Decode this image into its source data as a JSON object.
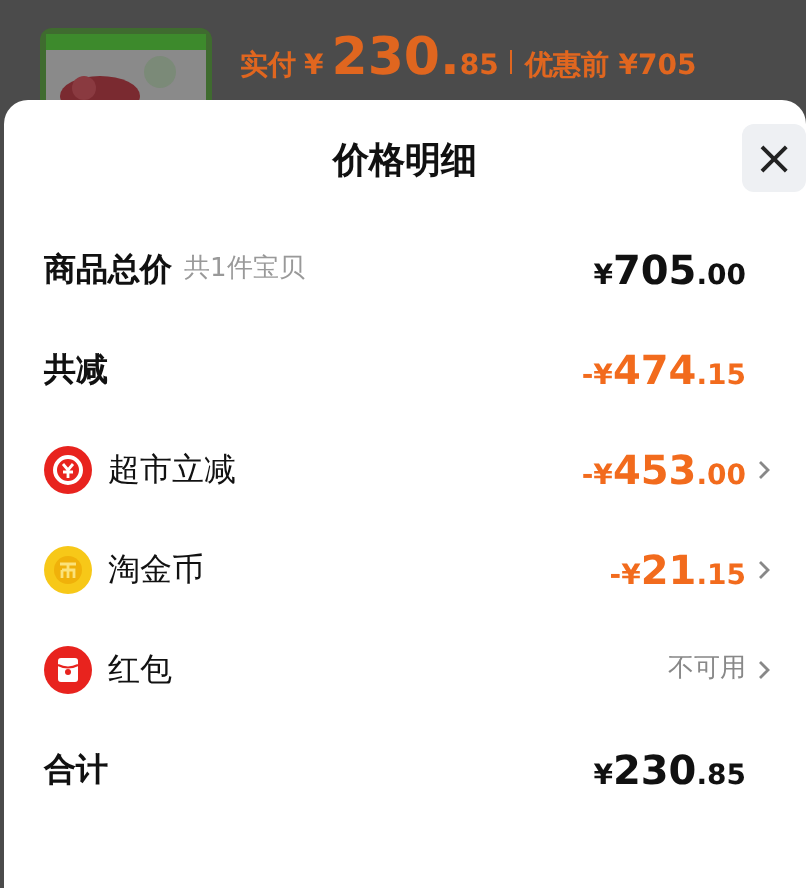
{
  "order_summary": {
    "paid_label": "实付",
    "paid_price": {
      "currency": "¥",
      "integer": "230.",
      "decimal": "85"
    },
    "original_label": "优惠前 ¥705"
  },
  "sheet": {
    "title": "价格明细",
    "close": "×",
    "rows": [
      {
        "kind": "total",
        "label": "商品总价",
        "note": "共1件宝贝",
        "value": {
          "kind": "amount",
          "negative": false,
          "currency": "¥",
          "integer": "705",
          "decimal": ".00"
        },
        "has_arrow": false
      },
      {
        "kind": "total",
        "label": "共减",
        "value": {
          "kind": "amount",
          "negative": true,
          "currency": "-¥",
          "integer": "474",
          "decimal": ".15"
        },
        "has_arrow": false
      },
      {
        "kind": "discount",
        "label": "超市立减",
        "value": {
          "kind": "amount",
          "negative": true,
          "currency": "-¥",
          "integer": "453",
          "decimal": ".00"
        },
        "has_arrow": true
      },
      {
        "kind": "coin",
        "label": "淘金币",
        "value": {
          "kind": "amount",
          "negative": true,
          "currency": "-¥",
          "integer": "21",
          "decimal": ".15"
        },
        "has_arrow": true
      },
      {
        "kind": "packet",
        "label": "红包",
        "value": {
          "kind": "status",
          "text": "不可用"
        },
        "has_arrow": true
      },
      {
        "kind": "total",
        "label": "合计",
        "value": {
          "kind": "amount",
          "negative": false,
          "currency": "¥",
          "integer": "230",
          "decimal": ".85"
        },
        "has_arrow": false
      }
    ]
  }
}
